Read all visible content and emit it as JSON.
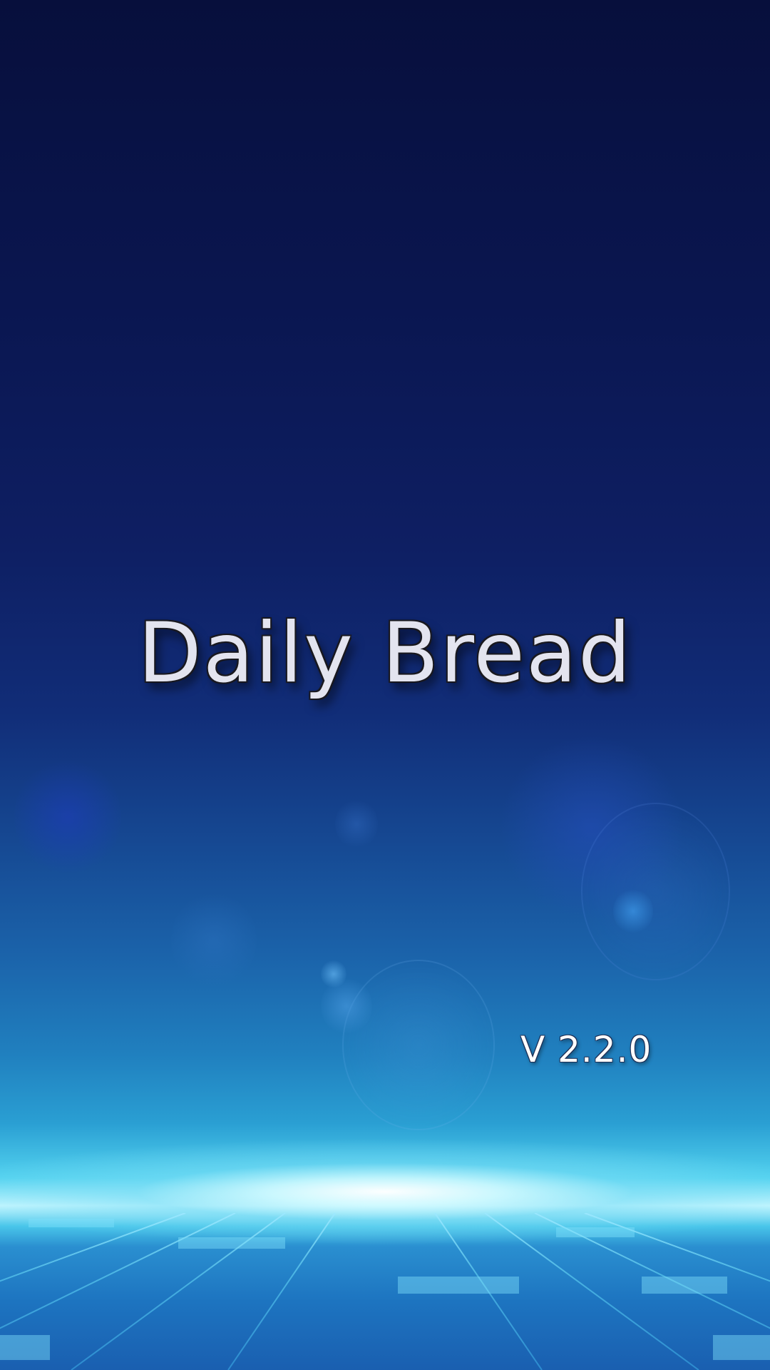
{
  "splash": {
    "app_name": "Daily Bread",
    "version": "V 2.2.0"
  },
  "colors": {
    "background_top": "#070f3c",
    "background_mid": "#164a94",
    "horizon_glow": "#c8f7ff",
    "floor_grid": "#5fd0f2",
    "title_text": "#e3e4ef",
    "version_text": "#ffffff"
  }
}
